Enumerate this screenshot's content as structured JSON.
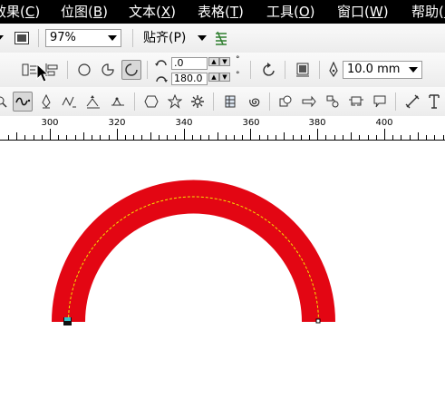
{
  "menu": [
    {
      "label": "效果(C)",
      "pre": "效果(",
      "key": "C",
      "post": ")"
    },
    {
      "label": "位图(B)",
      "pre": "位图(",
      "key": "B",
      "post": ")"
    },
    {
      "label": "文本(X)",
      "pre": "文本(",
      "key": "X",
      "post": ")"
    },
    {
      "label": "表格(T)",
      "pre": "表格(",
      "key": "T",
      "post": ")"
    },
    {
      "label": "工具(O)",
      "pre": "工具(",
      "key": "O",
      "post": ")"
    },
    {
      "label": "窗口(W)",
      "pre": "窗口(",
      "key": "W",
      "post": ")"
    },
    {
      "label": "帮助(H)",
      "pre": "帮助(",
      "key": "H",
      "post": ")"
    }
  ],
  "toolbar1": {
    "zoom_value": "97%",
    "snap_label": "贴齐(P)"
  },
  "toolbar2": {
    "start_angle": ".0",
    "end_angle": "180.0",
    "outline_width": "10.0 mm"
  },
  "ruler": {
    "labels": [
      "300",
      "320",
      "340",
      "360",
      "380",
      "400"
    ]
  },
  "colors": {
    "arc_fill": "#e30613",
    "path_dash": "#f3e600",
    "node_marker": "#35c2c8",
    "menubar_bg": "#000000"
  },
  "icons": {
    "toolbar1": [
      "view-manager-icon",
      "dropdown-icon",
      "snap-options-icon"
    ],
    "toolbar2": [
      "paragraph-wrap-icon",
      "align-icon",
      "ellipse-icon",
      "pie-icon",
      "arc-icon",
      "start-angle-icon",
      "end-angle-icon",
      "direction-icon",
      "convert-to-curves-icon",
      "outline-pen-icon"
    ],
    "toolbar3": [
      "zoom-icon",
      "freehand-icon",
      "pen-icon",
      "polyline-icon",
      "connector-icon",
      "polygon-icon",
      "star-icon",
      "complex-star-icon",
      "graph-paper-icon",
      "spiral-icon",
      "basic-shapes-icon",
      "arrow-shapes-icon",
      "flowchart-icon",
      "banner-icon",
      "callout-icon",
      "dimension-icon",
      "text-tool-icon"
    ]
  }
}
